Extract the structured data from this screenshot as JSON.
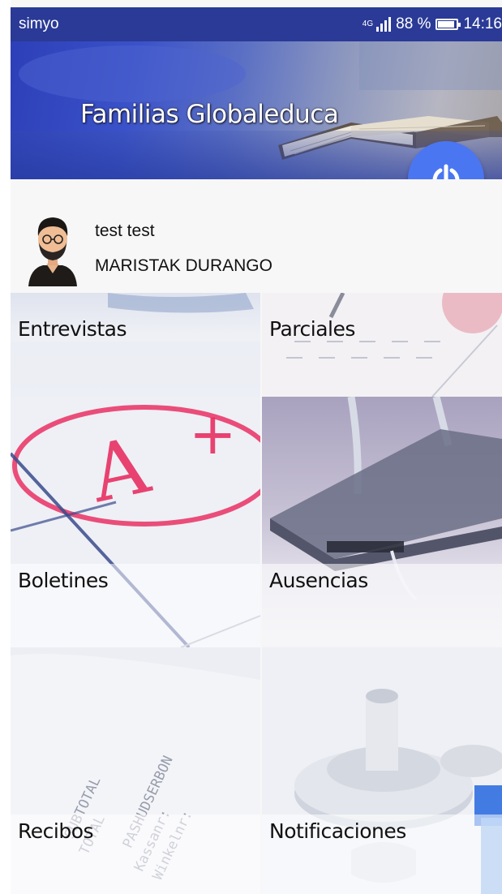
{
  "status_bar": {
    "carrier": "simyo",
    "network": "4G",
    "battery": "88 %",
    "battery_level": 0.88,
    "time": "14:16"
  },
  "header": {
    "title": "Familias Globaleduca"
  },
  "profile": {
    "name": "test test",
    "school": "MARISTAK DURANGO"
  },
  "menu": [
    {
      "label": "Entrevistas"
    },
    {
      "label": "Parciales"
    },
    {
      "label": "Boletines"
    },
    {
      "label": "Ausencias"
    },
    {
      "label": "Recibos"
    },
    {
      "label": "Notificaciones"
    }
  ],
  "colors": {
    "status_bar": "#2a3a96",
    "fab": "#4b76f2",
    "accent_red": "#e8245a"
  }
}
